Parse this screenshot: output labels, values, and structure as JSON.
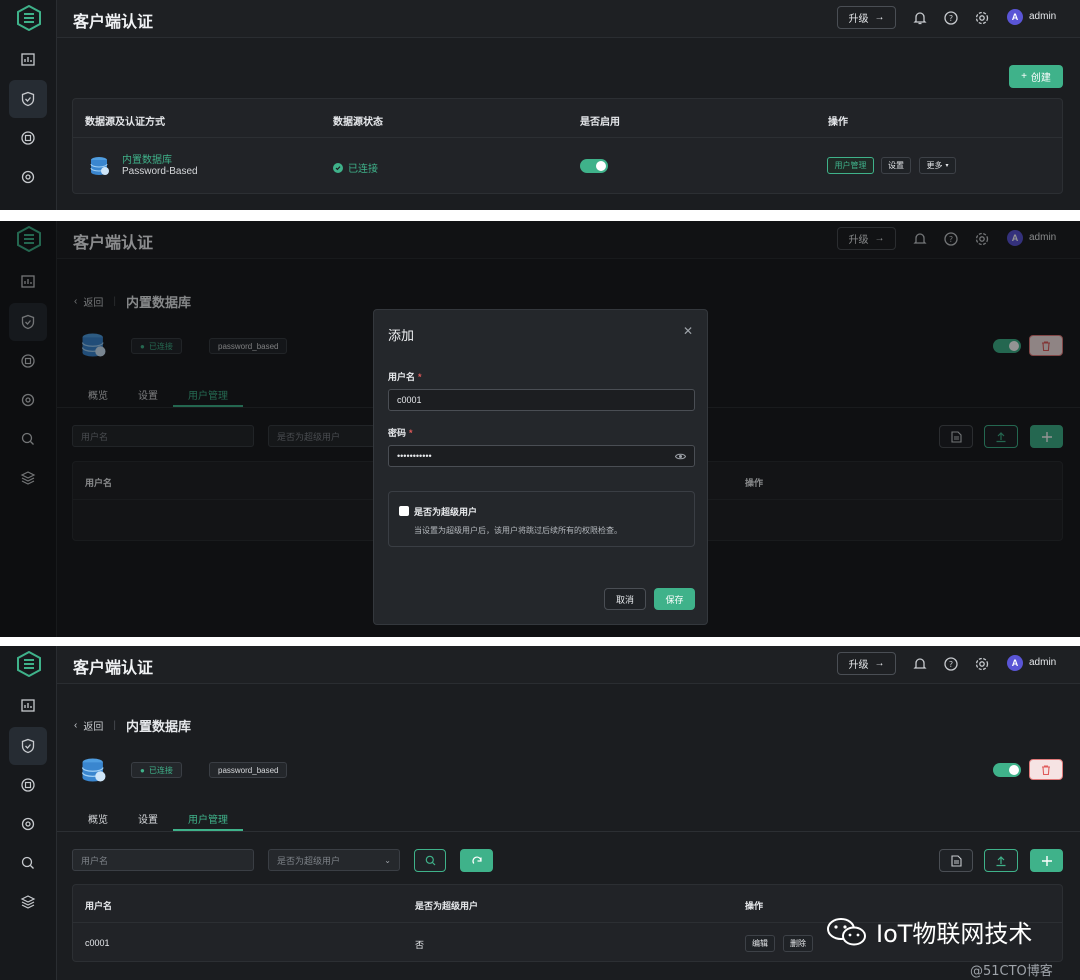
{
  "app": {
    "title": "客户端认证",
    "upgrade_label": "升级",
    "user_initial": "A",
    "user_name": "admin"
  },
  "colors": {
    "accent": "#3fb28a",
    "background": "#1b1d20",
    "danger": "#e05a5a"
  },
  "icons": [
    "logo-icon",
    "dashboard-icon",
    "shield-icon",
    "plugin-icon",
    "settings-cog-icon",
    "search-analysis-icon",
    "layers-icon",
    "bell-icon",
    "help-icon",
    "gear-icon",
    "database-icon",
    "trash-icon",
    "file-icon",
    "upload-icon",
    "plus-icon",
    "refresh-icon",
    "eye-icon",
    "check-icon"
  ],
  "list_view": {
    "create_label": "创建",
    "columns": [
      "数据源及认证方式",
      "数据源状态",
      "是否启用",
      "操作"
    ],
    "rows": [
      {
        "source": "内置数据库",
        "method": "Password-Based",
        "status": "已连接",
        "enabled": true,
        "actions": {
          "user_mgmt": "用户管理",
          "settings": "设置",
          "more": "更多"
        }
      }
    ]
  },
  "detail": {
    "back_label": "返回",
    "crumb": "内置数据库",
    "status_tag": "已连接",
    "method_tag": "password_based",
    "enabled": true,
    "tabs": [
      "概览",
      "设置",
      "用户管理"
    ],
    "active_tab": "用户管理",
    "filter": {
      "username_placeholder": "用户名",
      "superuser_placeholder": "是否为超级用户"
    },
    "columns": [
      "用户名",
      "是否为超级用户",
      "操作"
    ],
    "rows": [
      {
        "username": "c0001",
        "superuser": "否",
        "edit": "编辑",
        "delete": "删除"
      }
    ]
  },
  "dialog": {
    "title": "添加",
    "username_label": "用户名",
    "username_value": "c0001",
    "password_label": "密码",
    "password_value": "•••••••••••",
    "superuser_label": "是否为超级用户",
    "superuser_hint": "当设置为超级用户后，该用户将跳过后续所有的权限检查。",
    "cancel_label": "取消",
    "save_label": "保存"
  },
  "watermark": {
    "brand": "IoT物联网技术",
    "site": "@51CTO博客"
  }
}
